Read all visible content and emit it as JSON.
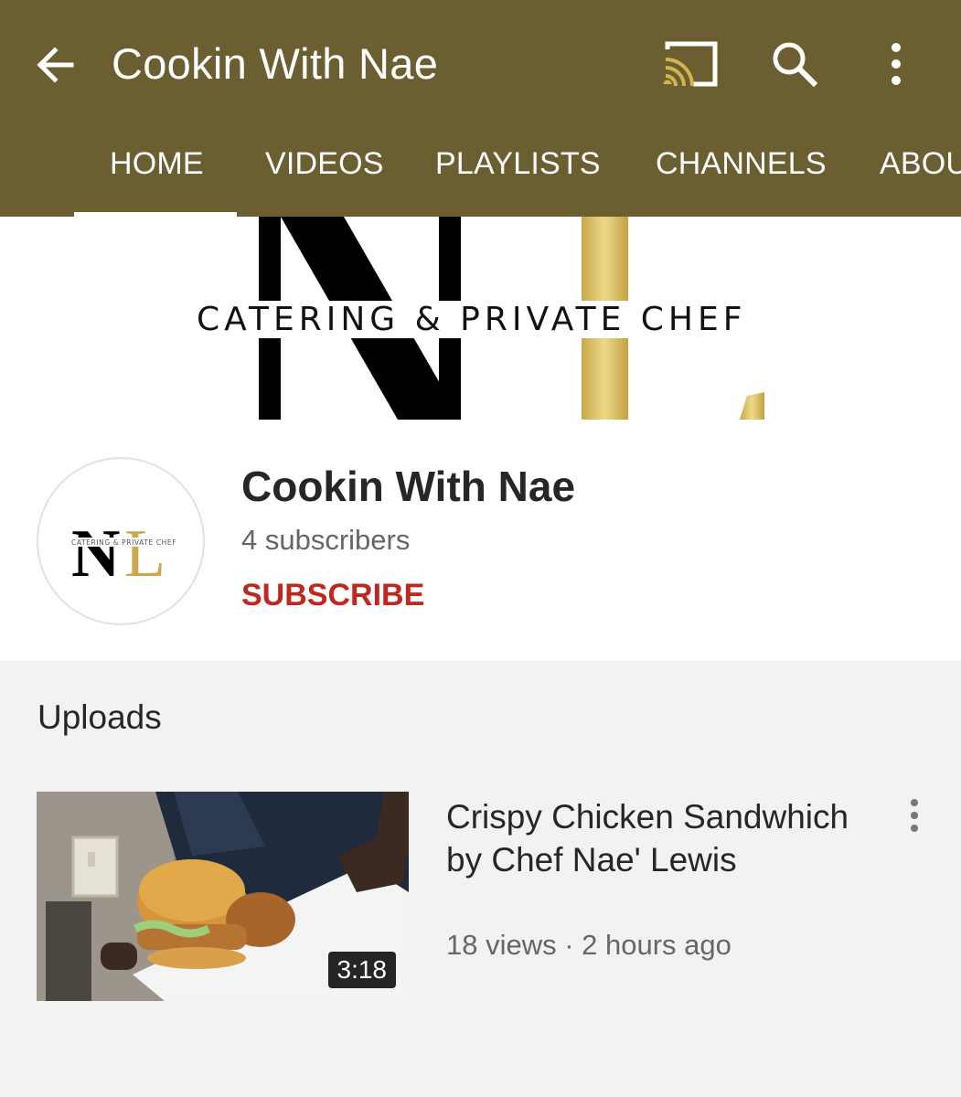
{
  "app_bar": {
    "title": "Cookin With Nae",
    "background_color": "#6b5e30",
    "icons": [
      "back-arrow-icon",
      "cast-icon",
      "search-icon",
      "more-vert-icon"
    ]
  },
  "tabs": [
    {
      "label": "HOME",
      "selected": true
    },
    {
      "label": "VIDEOS",
      "selected": false
    },
    {
      "label": "PLAYLISTS",
      "selected": false
    },
    {
      "label": "CHANNELS",
      "selected": false
    },
    {
      "label": "ABOUT",
      "selected": false
    }
  ],
  "banner": {
    "tagline": "CATERING & PRIVATE CHEF"
  },
  "channel": {
    "name": "Cookin With Nae",
    "subscribers": "4 subscribers",
    "subscribe_label": "SUBSCRIBE",
    "avatar": {
      "letters": "NL",
      "tagline": "CATERING & PRIVATE CHEF"
    }
  },
  "uploads": {
    "heading": "Uploads",
    "videos": [
      {
        "title": "Crispy Chicken Sandwhich by Chef Nae' Lewis",
        "meta": "18 views · 2 hours ago",
        "duration": "3:18"
      }
    ]
  },
  "colors": {
    "accent_gold": "#d4b34e",
    "subscribe_red": "#c0271f"
  }
}
